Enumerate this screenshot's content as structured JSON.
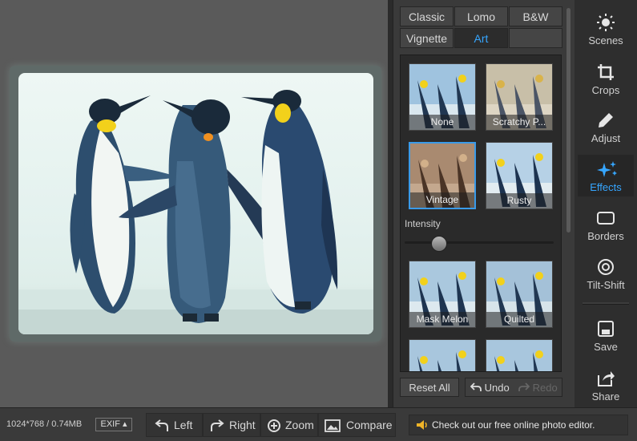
{
  "tabs": [
    {
      "label": "Classic"
    },
    {
      "label": "Lomo"
    },
    {
      "label": "B&W"
    },
    {
      "label": "Vignette"
    },
    {
      "label": "Art"
    },
    {
      "label": ""
    }
  ],
  "effects": [
    {
      "label": "None"
    },
    {
      "label": "Scratchy P..."
    },
    {
      "label": "Vintage"
    },
    {
      "label": "Rusty"
    },
    {
      "label": "Mask Melon"
    },
    {
      "label": "Quilted"
    },
    {
      "label": ""
    },
    {
      "label": ""
    }
  ],
  "intensity": {
    "label": "Intensity",
    "value": 0.2
  },
  "panel_buttons": {
    "reset": "Reset All",
    "undo": "Undo",
    "redo": "Redo"
  },
  "nav": [
    {
      "label": "Scenes",
      "icon": "sun-icon"
    },
    {
      "label": "Crops",
      "icon": "crop-icon"
    },
    {
      "label": "Adjust",
      "icon": "pencil-icon"
    },
    {
      "label": "Effects",
      "icon": "sparkle-icon"
    },
    {
      "label": "Borders",
      "icon": "border-icon"
    },
    {
      "label": "Tilt-Shift",
      "icon": "target-icon"
    },
    {
      "label": "Save",
      "icon": "floppy-icon"
    },
    {
      "label": "Share",
      "icon": "share-icon"
    }
  ],
  "status": {
    "info": "1024*768 / 0.74MB",
    "exif": "EXIF ▴",
    "left": "Left",
    "right": "Right",
    "zoom": "Zoom",
    "compare": "Compare",
    "notice": "Check out our free online photo editor."
  },
  "colors": {
    "accent": "#36a6ff",
    "panel": "#3a3a3a",
    "canvas": "#5a5a5a"
  }
}
